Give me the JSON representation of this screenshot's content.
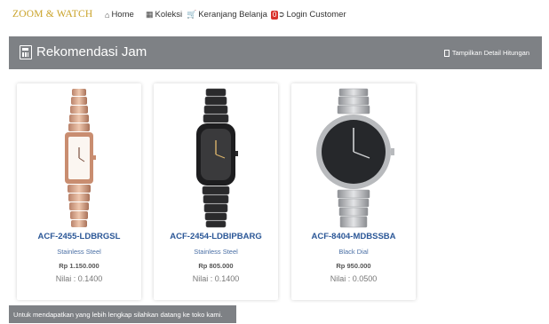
{
  "brand": "ZOOM & WATCH",
  "nav": {
    "home": "Home",
    "koleksi": "Koleksi",
    "keranjang": "Keranjang Belanja",
    "keranjang_count": "0",
    "login": "Login Customer"
  },
  "panel": {
    "title": "Rekomendasi Jam",
    "detail_link": "Tampilkan Detail Hitungan"
  },
  "products": [
    {
      "code": "ACF-2455-LDBRGSL",
      "desc": "Stainless Steel",
      "price": "Rp 1.150.000",
      "score": "Nilai : 0.1400",
      "image": "rose-gold-rectangular-watch"
    },
    {
      "code": "ACF-2454-LDBIPBARG",
      "desc": "Stainless Steel",
      "price": "Rp 805.000",
      "score": "Nilai : 0.1400",
      "image": "black-tonneau-watch"
    },
    {
      "code": "ACF-8404-MDBSSBA",
      "desc": "Black Dial",
      "price": "Rp 950.000",
      "score": "Nilai : 0.0500",
      "image": "silver-round-black-dial-watch"
    }
  ],
  "footer_note": "Untuk mendapatkan yang lebih lengkap silahkan datang ke toko kami.",
  "colors": {
    "brand": "#c9a227",
    "header_bar": "#7e8185",
    "product_code": "#2b5797",
    "badge": "#d9322b"
  }
}
